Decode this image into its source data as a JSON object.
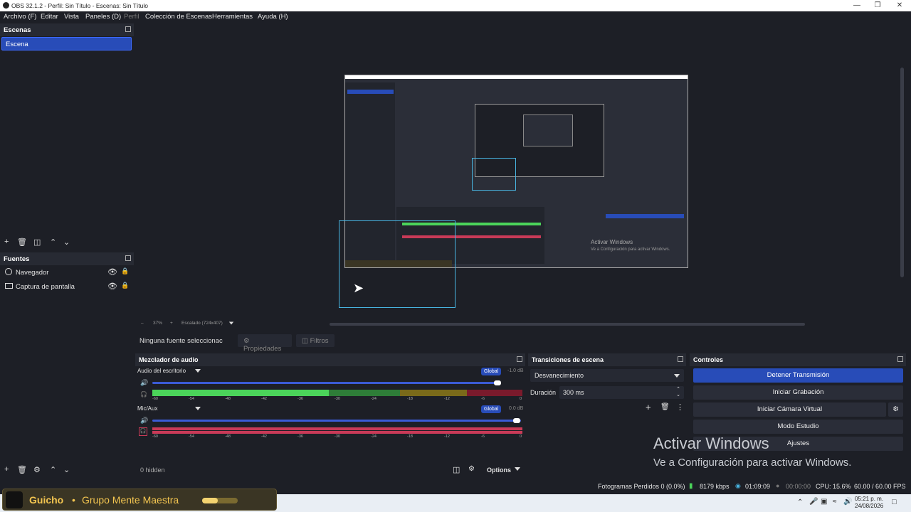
{
  "window": {
    "title": "OBS 32.1.2 - Perfil: Sin Título - Escenas: Sin Título"
  },
  "menu": [
    "Archivo (F)",
    "Editar",
    "Vista",
    "Paneles (D)",
    "Perfil",
    "Colección de Escenas",
    "Herramientas",
    "Ayuda (H)"
  ],
  "scenes": {
    "title": "Escenas",
    "items": [
      "Escena"
    ]
  },
  "sources": {
    "title": "Fuentes",
    "items": [
      "Navegador",
      "Captura de pantalla"
    ]
  },
  "preview": {
    "zoom": "37%",
    "scale_label": "Escalado (724x407)",
    "watermark_line1": "Activar Windows",
    "watermark_line2": "Ve a Configuración para activar Windows."
  },
  "context": {
    "no_source": "Ninguna fuente seleccionac",
    "properties": "Propiedades",
    "filters": "Filtros"
  },
  "mixer": {
    "title": "Mezclador de audio",
    "channels": [
      {
        "name": "Audio del escritorio",
        "badge": "Global",
        "db": "-1.0 dB",
        "volume": 0.96
      },
      {
        "name": "Mic/Aux",
        "badge": "Global",
        "db": "0.0 dB",
        "volume": 1.0
      }
    ],
    "ticks": [
      "-60",
      "-54",
      "-48",
      "-42",
      "-36",
      "-30",
      "-24",
      "-18",
      "-12",
      "-6",
      "0"
    ],
    "hidden": "0 hidden",
    "options": "Options"
  },
  "transitions": {
    "title": "Transiciones de escena",
    "selected": "Desvanecimiento",
    "duration_label": "Duración",
    "duration_value": "300 ms"
  },
  "controls": {
    "title": "Controles",
    "stop_stream": "Detener Transmisión",
    "start_record": "Iniciar Grabación",
    "virtual_cam": "Iniciar Cámara Virtual",
    "studio_mode": "Modo Estudio",
    "settings": "Ajustes"
  },
  "activate": {
    "line1": "Activar Windows",
    "line2": "Ve a Configuración para activar Windows."
  },
  "status": {
    "dropped": "Fotogramas Perdidos 0 (0.0%)",
    "bitrate": "8179 kbps",
    "stream_time": "01:09:09",
    "rec_time": "00:00:00",
    "cpu": "CPU: 15.6%",
    "fps": "60.00 / 60.00 FPS"
  },
  "taskbar": {
    "time": "05:21 p. m.",
    "date": "24/08/2026"
  },
  "toast": {
    "name": "Guicho",
    "group": "Grupo Mente Maestra",
    "progress": 0.45
  }
}
